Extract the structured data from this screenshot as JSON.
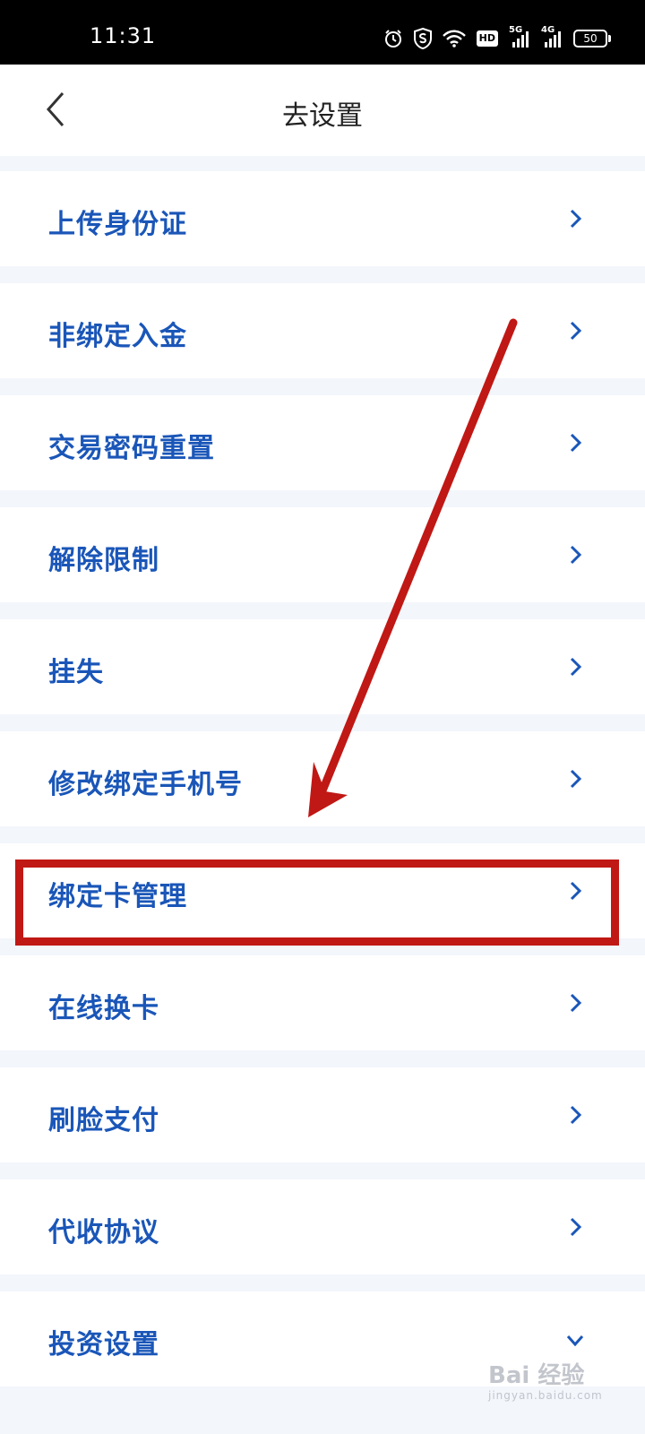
{
  "status_bar": {
    "time": "11:31",
    "hd_label": "HD",
    "sim1_label": "5G",
    "sim2_label": "4G",
    "battery": "50"
  },
  "header": {
    "title": "去设置",
    "back_icon": "chevron-left-icon"
  },
  "menu": {
    "items": [
      {
        "label": "上传身份证",
        "icon": "chevron-right-icon"
      },
      {
        "label": "非绑定入金",
        "icon": "chevron-right-icon"
      },
      {
        "label": "交易密码重置",
        "icon": "chevron-right-icon"
      },
      {
        "label": "解除限制",
        "icon": "chevron-right-icon"
      },
      {
        "label": "挂失",
        "icon": "chevron-right-icon"
      },
      {
        "label": "修改绑定手机号",
        "icon": "chevron-right-icon"
      },
      {
        "label": "绑定卡管理",
        "icon": "chevron-right-icon"
      },
      {
        "label": "在线换卡",
        "icon": "chevron-right-icon"
      },
      {
        "label": "刷脸支付",
        "icon": "chevron-right-icon"
      },
      {
        "label": "代收协议",
        "icon": "chevron-right-icon"
      },
      {
        "label": "投资设置",
        "icon": "chevron-down-icon"
      }
    ]
  },
  "annotation": {
    "highlighted_item": "绑定卡管理",
    "color": "#c01815"
  },
  "watermark": {
    "text": "Bai 经验",
    "subtext": "jingyan.baidu.com"
  },
  "colors": {
    "label": "#1a56b8",
    "background": "#f3f6fb"
  }
}
